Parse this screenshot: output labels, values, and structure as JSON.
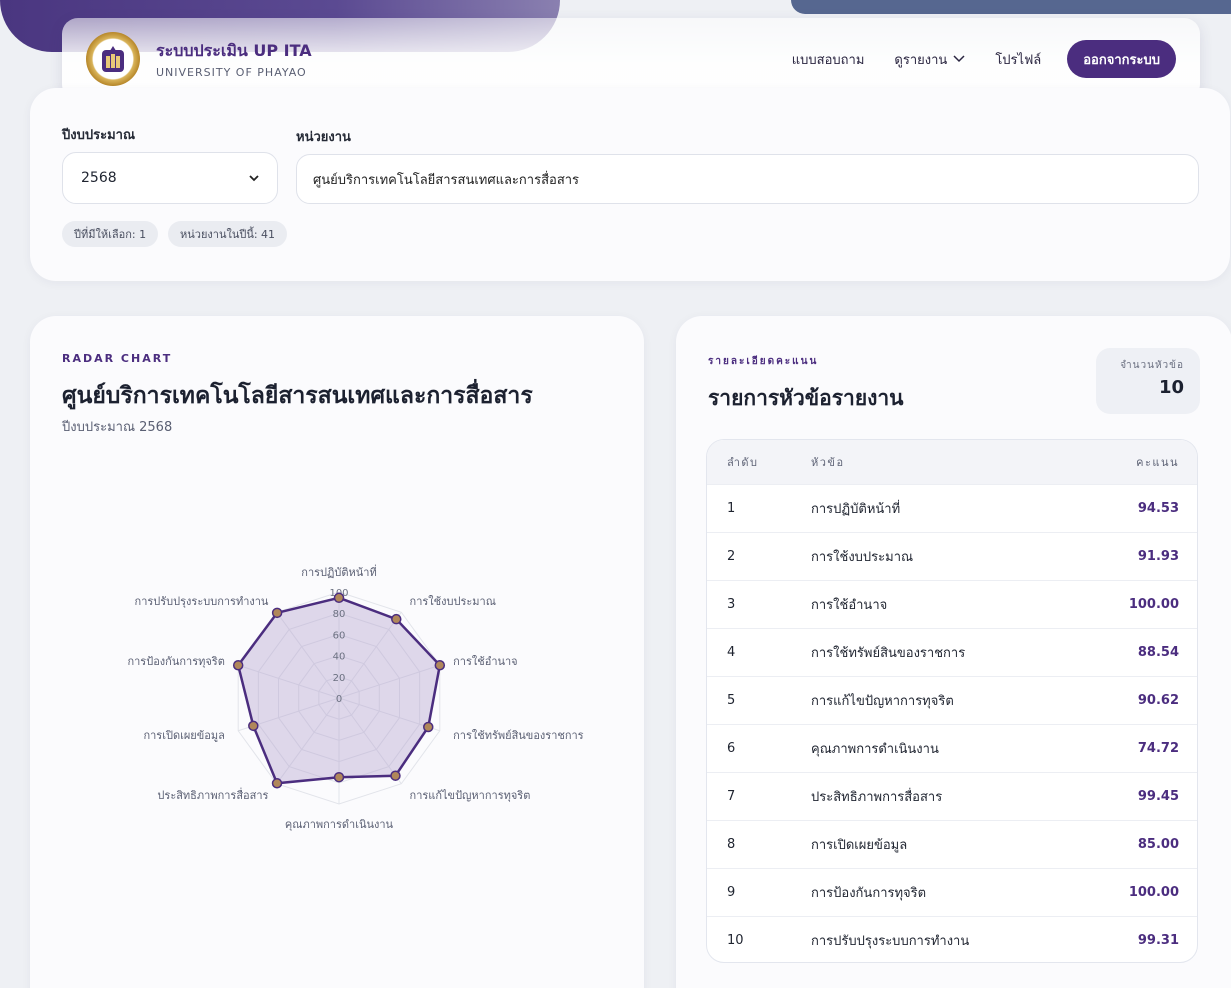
{
  "header": {
    "brand_title": "ระบบประเมิน UP ITA",
    "brand_subtitle": "UNIVERSITY OF PHAYAO",
    "logo_icon": "university-crest-icon",
    "nav": [
      {
        "label": "แบบสอบถาม"
      },
      {
        "label": "ดูรายงาน",
        "dropdown": true
      },
      {
        "label": "โปรไฟล์"
      }
    ],
    "logout_label": "ออกจากระบบ"
  },
  "filters": {
    "year_label": "ปีงบประมาณ",
    "year_value": "2568",
    "unit_label": "หน่วยงาน",
    "unit_value": "ศูนย์บริการเทคโนโลยีสารสนเทศและการสื่อสาร",
    "chips": [
      "ปีที่มีให้เลือก: 1",
      "หน่วยงานในปีนี้: 41"
    ]
  },
  "chart_panel": {
    "eyebrow": "RADAR CHART",
    "title": "ศูนย์บริการเทคโนโลยีสารสนเทศและการสื่อสาร",
    "subtitle": "ปีงบประมาณ 2568"
  },
  "chart_data": {
    "type": "radar",
    "categories": [
      "การปฏิบัติหน้าที่",
      "การใช้งบประมาณ",
      "การใช้อำนาจ",
      "การใช้ทรัพย์สินของราชการ",
      "การแก้ไขปัญหาการทุจริต",
      "คุณภาพการดำเนินงาน",
      "ประสิทธิภาพการสื่อสาร",
      "การเปิดเผยข้อมูล",
      "การป้องกันการทุจริต",
      "การปรับปรุงระบบการทำงาน"
    ],
    "values": [
      94.53,
      91.93,
      100.0,
      88.54,
      90.62,
      74.72,
      99.45,
      85.0,
      100.0,
      99.31
    ],
    "rlim": [
      0,
      100
    ],
    "ticks": [
      "0",
      "20",
      "40",
      "60",
      "80",
      "100"
    ],
    "colors": {
      "line": "#4b2d7f",
      "fill": "#b4a4cf",
      "point": "#b0875a"
    }
  },
  "table_panel": {
    "eyebrow": "รายละเอียดคะแนน",
    "title": "รายการหัวข้อรายงาน",
    "count_label": "จำนวนหัวข้อ",
    "count_value": "10",
    "columns": [
      "ลำดับ",
      "หัวข้อ",
      "คะแนน"
    ],
    "rows": [
      {
        "idx": "1",
        "name": "การปฏิบัติหน้าที่",
        "score": "94.53"
      },
      {
        "idx": "2",
        "name": "การใช้งบประมาณ",
        "score": "91.93"
      },
      {
        "idx": "3",
        "name": "การใช้อำนาจ",
        "score": "100.00"
      },
      {
        "idx": "4",
        "name": "การใช้ทรัพย์สินของราชการ",
        "score": "88.54"
      },
      {
        "idx": "5",
        "name": "การแก้ไขปัญหาการทุจริต",
        "score": "90.62"
      },
      {
        "idx": "6",
        "name": "คุณภาพการดำเนินงาน",
        "score": "74.72"
      },
      {
        "idx": "7",
        "name": "ประสิทธิภาพการสื่อสาร",
        "score": "99.45"
      },
      {
        "idx": "8",
        "name": "การเปิดเผยข้อมูล",
        "score": "85.00"
      },
      {
        "idx": "9",
        "name": "การป้องกันการทุจริต",
        "score": "100.00"
      },
      {
        "idx": "10",
        "name": "การปรับปรุงระบบการทำงาน",
        "score": "99.31"
      }
    ]
  }
}
